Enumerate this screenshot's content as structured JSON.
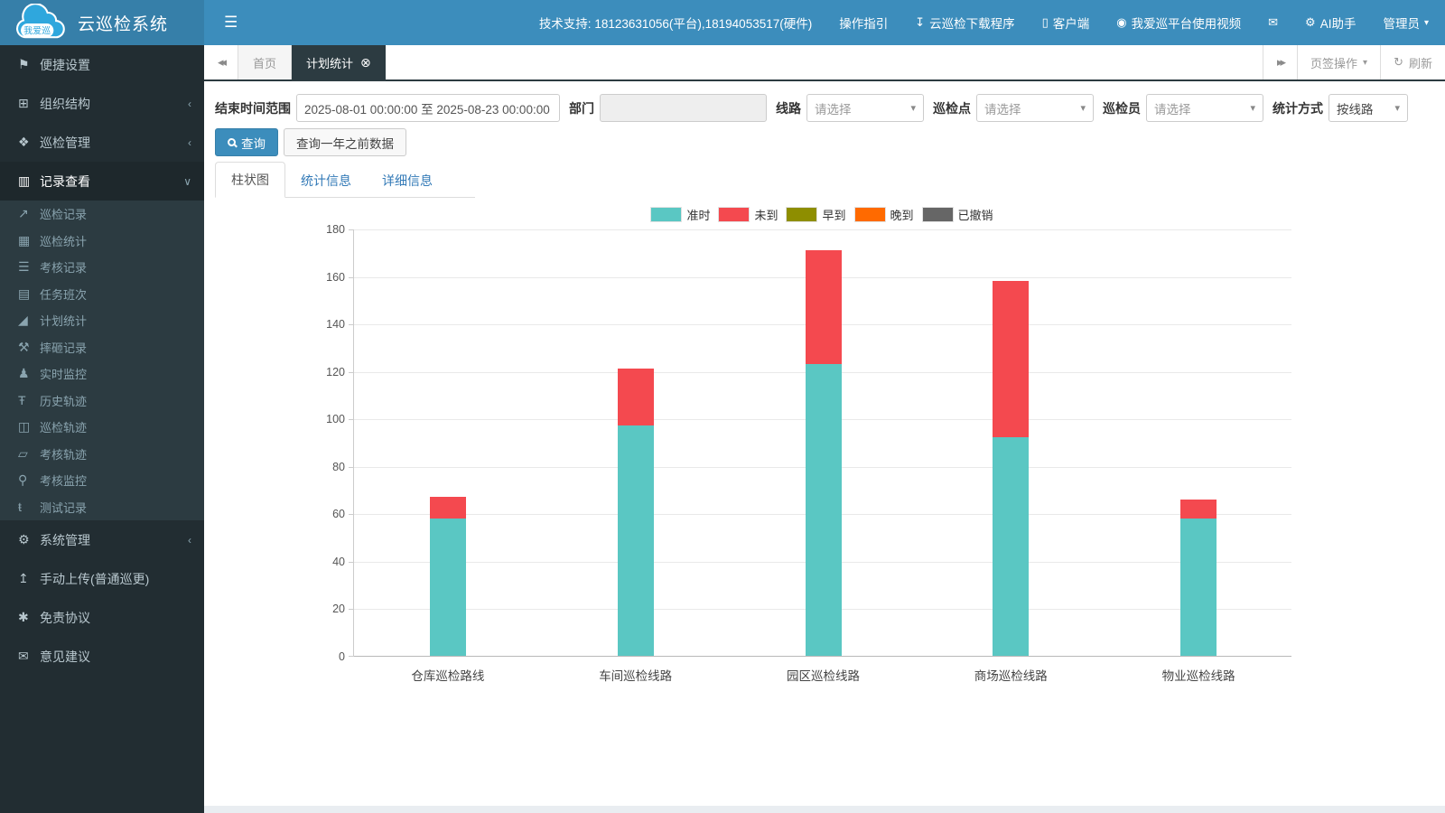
{
  "brand": {
    "logo_text": "我爱巡",
    "title": "云巡检系统"
  },
  "navbar": {
    "support_text": "技术支持: 18123631056(平台),18194053517(硬件)",
    "items": [
      {
        "id": "operation-guide",
        "icon": null,
        "label": "操作指引"
      },
      {
        "id": "download-app",
        "icon": "download",
        "label": "云巡检下载程序"
      },
      {
        "id": "client",
        "icon": "mobile",
        "label": "客户端"
      },
      {
        "id": "platform-video",
        "icon": "video",
        "label": "我爱巡平台使用视频"
      },
      {
        "id": "messages",
        "icon": "envelope",
        "label": ""
      },
      {
        "id": "ai-assistant",
        "icon": "gear",
        "label": "AI助手"
      },
      {
        "id": "admin-menu",
        "icon": null,
        "label": "管理员",
        "caret": true
      }
    ]
  },
  "sidebar": {
    "items": [
      {
        "id": "quick-settings",
        "label": "便捷设置",
        "icon": "flag"
      },
      {
        "id": "org-structure",
        "label": "组织结构",
        "icon": "sitemap",
        "chevron": "left"
      },
      {
        "id": "inspection-management",
        "label": "巡检管理",
        "icon": "binoculars",
        "chevron": "left"
      },
      {
        "id": "record-view",
        "label": "记录查看",
        "icon": "bar-chart",
        "chevron": "down",
        "active": true,
        "children": [
          {
            "id": "inspection-records",
            "label": "巡检记录",
            "icon": "line-chart"
          },
          {
            "id": "inspection-stats",
            "label": "巡检统计",
            "icon": "table"
          },
          {
            "id": "assessment-records",
            "label": "考核记录",
            "icon": "list"
          },
          {
            "id": "task-shifts",
            "label": "任务班次",
            "icon": "calendar"
          },
          {
            "id": "plan-stats",
            "label": "计划统计",
            "icon": "area-chart"
          },
          {
            "id": "smash-records",
            "label": "摔砸记录",
            "icon": "gavel"
          },
          {
            "id": "realtime-monitor",
            "label": "实时监控",
            "icon": "street-view"
          },
          {
            "id": "history-track",
            "label": "历史轨迹",
            "icon": "signpost"
          },
          {
            "id": "inspection-track",
            "label": "巡检轨迹",
            "icon": "map"
          },
          {
            "id": "assessment-track",
            "label": "考核轨迹",
            "icon": "map-outline"
          },
          {
            "id": "assessment-monitor",
            "label": "考核监控",
            "icon": "map-marker"
          },
          {
            "id": "test-records",
            "label": "测试记录",
            "icon": "test"
          }
        ]
      },
      {
        "id": "system-management",
        "label": "系统管理",
        "icon": "gear",
        "chevron": "left"
      },
      {
        "id": "manual-upload",
        "label": "手动上传(普通巡更)",
        "icon": "upload"
      },
      {
        "id": "disclaimer",
        "label": "免责协议",
        "icon": "asterisk"
      },
      {
        "id": "feedback",
        "label": "意见建议",
        "icon": "envelope"
      }
    ]
  },
  "tabstrip": {
    "tabs": [
      {
        "id": "home",
        "label": "首页",
        "active": false,
        "closable": false
      },
      {
        "id": "plan-stats",
        "label": "计划统计",
        "active": true,
        "closable": true
      }
    ],
    "tab_ops_label": "页签操作",
    "refresh_label": "刷新"
  },
  "filters": {
    "time_label": "结束时间范围",
    "time_value": "2025-08-01 00:00:00 至 2025-08-23 00:00:00",
    "dept_label": "部门",
    "dept_value": "",
    "line_label": "线路",
    "line_placeholder": "请选择",
    "point_label": "巡检点",
    "point_placeholder": "请选择",
    "person_label": "巡检员",
    "person_placeholder": "请选择",
    "stat_label": "统计方式",
    "stat_value": "按线路"
  },
  "actions": {
    "query_label": "查询",
    "query_old_label": "查询一年之前数据"
  },
  "content_tabs": [
    {
      "id": "bar-chart",
      "label": "柱状图",
      "active": true
    },
    {
      "id": "stats-info",
      "label": "统计信息",
      "active": false
    },
    {
      "id": "detail-info",
      "label": "详细信息",
      "active": false
    }
  ],
  "chart_data": {
    "type": "bar",
    "stacked": true,
    "title": "",
    "xlabel": "",
    "ylabel": "",
    "categories": [
      "仓库巡检路线",
      "车间巡检线路",
      "园区巡检线路",
      "商场巡检线路",
      "物业巡检线路"
    ],
    "series": [
      {
        "name": "准时",
        "color": "#5AC7C3",
        "values": [
          58,
          97,
          123,
          92,
          58
        ]
      },
      {
        "name": "未到",
        "color": "#F4494F",
        "values": [
          9,
          24,
          48,
          66,
          8
        ]
      },
      {
        "name": "早到",
        "color": "#8E8E00",
        "values": [
          0,
          0,
          0,
          0,
          0
        ]
      },
      {
        "name": "晚到",
        "color": "#FF6A00",
        "values": [
          0,
          0,
          0,
          0,
          0
        ]
      },
      {
        "name": "已撤销",
        "color": "#666666",
        "values": [
          0,
          0,
          0,
          0,
          0
        ]
      }
    ],
    "ylim": [
      0,
      180
    ],
    "ytick_step": 20,
    "grid": true,
    "legend_position": "top"
  },
  "colors": {
    "navbar": "#3c8dbc",
    "brand_bg": "#367fa9",
    "sidebar": "#222d32",
    "sidebar_active": "#1e282c",
    "submenu": "#2c3b41",
    "tab_active": "#2c3b41",
    "primary": "#3c8dbc",
    "link": "#337ab7"
  },
  "icons": {
    "menu": "☰",
    "flag": "⚑",
    "sitemap": "⊞",
    "binoculars": "❖",
    "bar-chart": "▥",
    "line-chart": "↗",
    "table": "▦",
    "list": "☰",
    "calendar": "▤",
    "area-chart": "◢",
    "gavel": "⚒",
    "street-view": "♟",
    "signpost": "Ŧ",
    "map": "◫",
    "map-outline": "▱",
    "map-marker": "⚲",
    "test": "ŧ",
    "gear": "⚙",
    "upload": "↥",
    "asterisk": "✱",
    "envelope": "✉",
    "download": "↧",
    "mobile": "▯",
    "video": "◉",
    "caret-down": "▾",
    "chevron-left": "‹",
    "chevron-down": "∨",
    "close-circle": "⊗",
    "refresh": "↻",
    "backward": "◂◂",
    "forward": "▸▸"
  }
}
